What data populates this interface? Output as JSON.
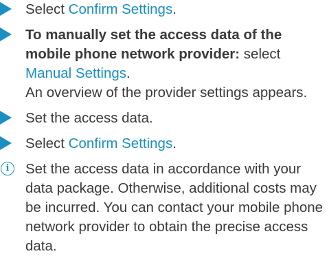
{
  "steps": [
    {
      "prefix": "Select ",
      "link": "Confirm Settings",
      "suffix": "."
    },
    {
      "bold_lead": "To manually set the access data of the mobile phone network provider:",
      "prefix": " select ",
      "link": "Manual Settings",
      "suffix": ".",
      "result": "An overview of the provider settings appears."
    },
    {
      "text": "Set the access data."
    },
    {
      "prefix": "Select ",
      "link": "Confirm Settings",
      "suffix": "."
    }
  ],
  "note": {
    "icon": "info-icon",
    "icon_glyph": "i",
    "text": "Set the access data in accordance with your data package. Otherwise, additional costs may be incurred. You can contact your mobile phone network provider to obtain the precise access data."
  },
  "colors": {
    "accent": "#1b8fc1",
    "text": "#3a3a3a"
  }
}
